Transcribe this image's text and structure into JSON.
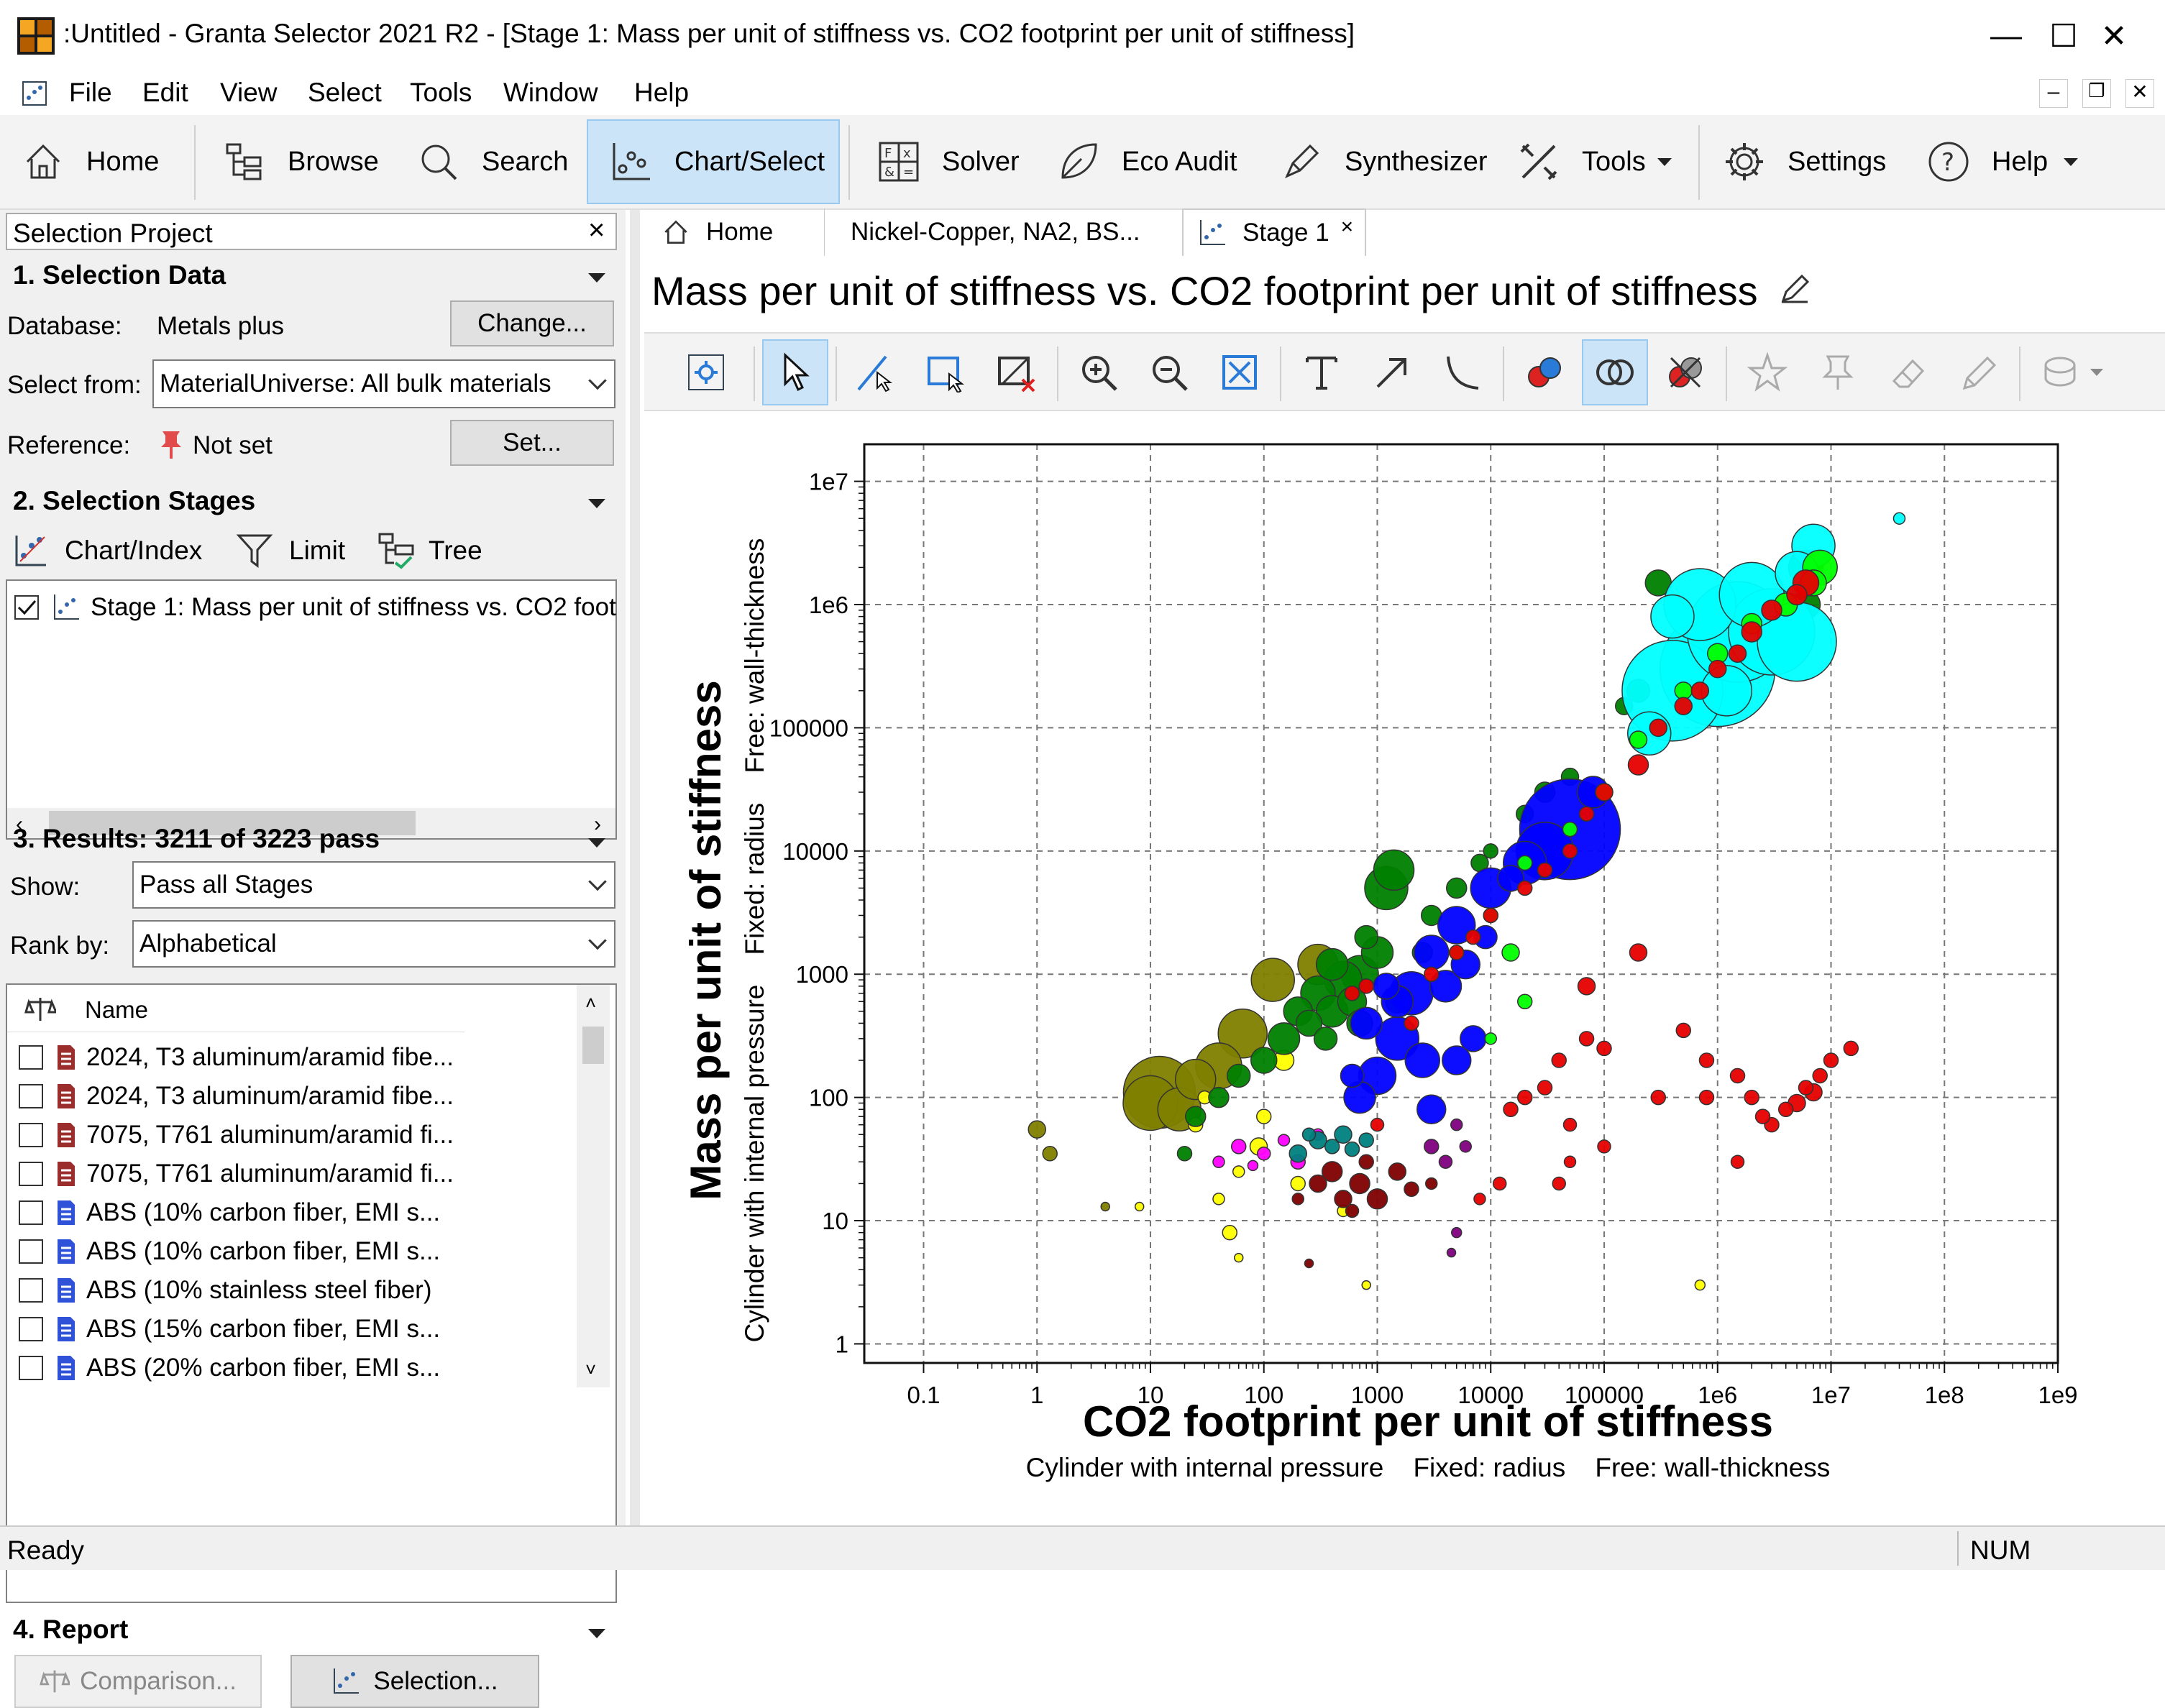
{
  "window": {
    "title": ":Untitled - Granta Selector 2021 R2 - [Stage 1: Mass per unit of stiffness vs. CO2 footprint per unit of stiffness]",
    "minimize": "—",
    "maximize": "☐",
    "close": "✕"
  },
  "menu": {
    "items": [
      "File",
      "Edit",
      "View",
      "Select",
      "Tools",
      "Window",
      "Help"
    ]
  },
  "ribbon": {
    "home": "Home",
    "browse": "Browse",
    "search": "Search",
    "chart_select": "Chart/Select",
    "solver": "Solver",
    "eco_audit": "Eco Audit",
    "synthesizer": "Synthesizer",
    "tools": "Tools",
    "settings": "Settings",
    "help": "Help"
  },
  "left_panel": {
    "header": "Selection Project",
    "close": "×",
    "selection_data": {
      "title": "1. Selection Data",
      "database_label": "Database:",
      "database_value": "Metals plus",
      "change_button": "Change...",
      "select_from_label": "Select from:",
      "select_from_value": "MaterialUniverse: All bulk materials",
      "reference_label": "Reference:",
      "reference_value": "Not set",
      "set_button": "Set..."
    },
    "selection_stages": {
      "title": "2. Selection Stages",
      "chart_index": "Chart/Index",
      "limit": "Limit",
      "tree": "Tree",
      "stages": [
        "Stage 1: Mass per unit of stiffness vs. CO2 foot"
      ]
    },
    "results": {
      "title": "3. Results: 3211 of 3223 pass",
      "show_label": "Show:",
      "show_value": "Pass all Stages",
      "rank_label": "Rank by:",
      "rank_value": "Alphabetical",
      "name_header": "Name",
      "rows": [
        {
          "name": "2024, T3 aluminum/aramid fibe...",
          "color": "#9b2d2d"
        },
        {
          "name": "2024, T3 aluminum/aramid fibe...",
          "color": "#9b2d2d"
        },
        {
          "name": "7075, T761 aluminum/aramid fi...",
          "color": "#9b2d2d"
        },
        {
          "name": "7075, T761 aluminum/aramid fi...",
          "color": "#9b2d2d"
        },
        {
          "name": "ABS (10% carbon fiber, EMI s...",
          "color": "#2f52d8"
        },
        {
          "name": "ABS (10% carbon fiber, EMI s...",
          "color": "#2f52d8"
        },
        {
          "name": "ABS (10% stainless steel fiber)",
          "color": "#2f52d8"
        },
        {
          "name": "ABS (15% carbon fiber, EMI s...",
          "color": "#2f52d8"
        },
        {
          "name": "ABS (20% carbon fiber, EMI s...",
          "color": "#2f52d8"
        }
      ]
    },
    "report": {
      "title": "4. Report",
      "comparison": "Comparison...",
      "selection": "Selection..."
    }
  },
  "tabs": [
    {
      "label": "Home"
    },
    {
      "label": "Nickel-Copper, NA2, BS..."
    },
    {
      "label": "Stage 1",
      "close": "×"
    }
  ],
  "chart_title": "Mass per unit of stiffness vs. CO2 footprint per unit of stiffness",
  "status": {
    "text": "Ready",
    "num": "NUM"
  },
  "chart_data": {
    "type": "scatter",
    "x_scale": "log",
    "y_scale": "log",
    "xlim": [
      0.03,
      1000000000.0
    ],
    "ylim": [
      0.7,
      20000000.0
    ],
    "grid": true,
    "xlabel": "CO2 footprint per unit of stiffness",
    "xsublabel": "Cylinder with internal pressure    Fixed: radius    Free: wall-thickness",
    "ylabel": "Mass per unit of stiffness",
    "ysublabel": "Cylinder with internal pressure    Fixed: radius    Free: wall-thickness",
    "x_ticks": [
      "0.1",
      "1",
      "10",
      "100",
      "1000",
      "10000",
      "100000",
      "1e6",
      "1e7",
      "1e8",
      "1e9"
    ],
    "y_ticks": [
      "1",
      "10",
      "100",
      "1000",
      "10000",
      "100000",
      "1e6",
      "1e7"
    ],
    "series": [
      {
        "color": "#808000",
        "points": [
          [
            1,
            55,
            12
          ],
          [
            1.3,
            35,
            10
          ],
          [
            4,
            13,
            6
          ],
          [
            12,
            110,
            50
          ],
          [
            10,
            90,
            38
          ],
          [
            18,
            80,
            30
          ],
          [
            25,
            140,
            28
          ],
          [
            40,
            180,
            32
          ],
          [
            65,
            330,
            34
          ],
          [
            120,
            900,
            30
          ],
          [
            300,
            1200,
            28
          ]
        ]
      },
      {
        "color": "#ffff00",
        "points": [
          [
            8,
            13,
            6
          ],
          [
            25,
            60,
            10
          ],
          [
            40,
            15,
            8
          ],
          [
            50,
            8,
            10
          ],
          [
            60,
            5,
            6
          ],
          [
            90,
            40,
            12
          ],
          [
            150,
            200,
            14
          ],
          [
            200,
            20,
            10
          ],
          [
            500,
            12,
            8
          ],
          [
            800,
            3,
            6
          ],
          [
            700000,
            3,
            7
          ],
          [
            30,
            100,
            9
          ],
          [
            100,
            70,
            10
          ],
          [
            60,
            25,
            8
          ]
        ]
      },
      {
        "color": "#ff00ff",
        "points": [
          [
            40,
            30,
            8
          ],
          [
            60,
            40,
            10
          ],
          [
            100,
            35,
            9
          ],
          [
            150,
            45,
            8
          ],
          [
            200,
            30,
            10
          ],
          [
            300,
            50,
            8
          ],
          [
            80,
            28,
            7
          ]
        ]
      },
      {
        "color": "#008080",
        "points": [
          [
            200,
            35,
            12
          ],
          [
            300,
            45,
            12
          ],
          [
            400,
            40,
            10
          ],
          [
            500,
            50,
            12
          ],
          [
            600,
            38,
            10
          ],
          [
            800,
            45,
            10
          ],
          [
            250,
            50,
            9
          ]
        ]
      },
      {
        "color": "#800000",
        "points": [
          [
            200,
            15,
            8
          ],
          [
            250,
            4.5,
            6
          ],
          [
            300,
            20,
            12
          ],
          [
            400,
            25,
            14
          ],
          [
            500,
            15,
            12
          ],
          [
            700,
            20,
            14
          ],
          [
            1000,
            15,
            14
          ],
          [
            1500,
            25,
            12
          ],
          [
            2000,
            18,
            10
          ],
          [
            800,
            30,
            10
          ],
          [
            3000,
            20,
            8
          ],
          [
            600,
            12,
            9
          ]
        ]
      },
      {
        "color": "#800080",
        "points": [
          [
            5000,
            60,
            8
          ],
          [
            5000,
            8,
            7
          ],
          [
            4500,
            5.5,
            6
          ],
          [
            6000,
            40,
            8
          ],
          [
            3000,
            40,
            10
          ],
          [
            4000,
            30,
            9
          ]
        ]
      },
      {
        "color": "#008000",
        "points": [
          [
            1200,
            5000,
            30
          ],
          [
            1400,
            7000,
            28
          ],
          [
            1000,
            1500,
            22
          ],
          [
            700,
            1000,
            26
          ],
          [
            500,
            900,
            26
          ],
          [
            300,
            700,
            24
          ],
          [
            400,
            1200,
            22
          ],
          [
            200,
            500,
            20
          ],
          [
            150,
            300,
            22
          ],
          [
            100,
            200,
            18
          ],
          [
            60,
            150,
            16
          ],
          [
            40,
            100,
            14
          ],
          [
            25,
            70,
            14
          ],
          [
            800,
            2000,
            16
          ],
          [
            2500,
            1500,
            14
          ],
          [
            5000,
            5000,
            14
          ],
          [
            8000,
            8000,
            12
          ],
          [
            3000,
            3000,
            14
          ],
          [
            600,
            600,
            20
          ],
          [
            400,
            500,
            22
          ],
          [
            250,
            400,
            18
          ],
          [
            20,
            35,
            10
          ],
          [
            700,
            400,
            18
          ],
          [
            1500,
            600,
            16
          ],
          [
            350,
            300,
            16
          ],
          [
            30000,
            30000,
            14
          ],
          [
            200000,
            200000,
            16
          ],
          [
            1000000,
            1000000,
            14
          ],
          [
            6000000,
            2000000,
            24
          ],
          [
            6000000,
            1000000,
            20
          ],
          [
            50000,
            40000,
            12
          ],
          [
            20000,
            20000,
            12
          ],
          [
            10000,
            10000,
            10
          ],
          [
            300000,
            1500000,
            18
          ],
          [
            150000,
            150000,
            12
          ],
          [
            3000000,
            600000,
            16
          ]
        ]
      },
      {
        "color": "#0000ff",
        "points": [
          [
            50000,
            15000,
            70
          ],
          [
            30000,
            10000,
            40
          ],
          [
            20000,
            8000,
            30
          ],
          [
            10000,
            5000,
            28
          ],
          [
            5000,
            2500,
            26
          ],
          [
            3000,
            1500,
            24
          ],
          [
            2000,
            700,
            30
          ],
          [
            1500,
            300,
            30
          ],
          [
            1000,
            150,
            26
          ],
          [
            700,
            100,
            22
          ],
          [
            3000,
            80,
            20
          ],
          [
            5000,
            200,
            20
          ],
          [
            800,
            400,
            22
          ],
          [
            4000,
            800,
            22
          ],
          [
            6000,
            1200,
            20
          ],
          [
            2500,
            200,
            24
          ],
          [
            1500,
            600,
            22
          ],
          [
            7000,
            300,
            18
          ],
          [
            600,
            150,
            16
          ],
          [
            1200,
            800,
            18
          ],
          [
            9000,
            2000,
            16
          ],
          [
            15000,
            6000,
            18
          ],
          [
            80000,
            30000,
            22
          ],
          [
            250000,
            100000,
            8
          ]
        ]
      },
      {
        "color": "#00ffff",
        "points": [
          [
            40000000,
            5000000,
            8
          ],
          [
            400000,
            200000,
            70
          ],
          [
            1000000,
            300000,
            80
          ],
          [
            1500000,
            600000,
            70
          ],
          [
            3000000,
            600000,
            60
          ],
          [
            5000000,
            500000,
            55
          ],
          [
            700000,
            1000000,
            50
          ],
          [
            2000000,
            1200000,
            45
          ],
          [
            7000000,
            3000000,
            30
          ],
          [
            5000000,
            1800000,
            30
          ],
          [
            250000,
            90000,
            30
          ],
          [
            400000,
            800000,
            30
          ],
          [
            1200000,
            200000,
            35
          ]
        ]
      },
      {
        "color": "#00ff00",
        "points": [
          [
            8000000,
            2000000,
            24
          ],
          [
            7000000,
            1500000,
            18
          ],
          [
            4000000,
            1000000,
            16
          ],
          [
            2000000,
            700000,
            14
          ],
          [
            1000000,
            400000,
            14
          ],
          [
            500000,
            200000,
            12
          ],
          [
            200000,
            80000,
            12
          ],
          [
            100000,
            30000,
            12
          ],
          [
            50000,
            15000,
            10
          ],
          [
            20000,
            8000,
            10
          ],
          [
            10000,
            3000,
            10
          ],
          [
            5000,
            1500,
            10
          ],
          [
            15000,
            1500,
            12
          ],
          [
            20000,
            600,
            10
          ],
          [
            10000,
            300,
            8
          ]
        ]
      },
      {
        "color": "#e60000",
        "points": [
          [
            6000000,
            1500000,
            18
          ],
          [
            5000000,
            1200000,
            14
          ],
          [
            3000000,
            900000,
            14
          ],
          [
            2000000,
            600000,
            14
          ],
          [
            1500000,
            400000,
            12
          ],
          [
            1000000,
            300000,
            12
          ],
          [
            700000,
            200000,
            12
          ],
          [
            500000,
            150000,
            12
          ],
          [
            300000,
            100000,
            12
          ],
          [
            200000,
            50000,
            14
          ],
          [
            100000,
            30000,
            12
          ],
          [
            70000,
            20000,
            10
          ],
          [
            50000,
            10000,
            10
          ],
          [
            30000,
            7000,
            10
          ],
          [
            20000,
            5000,
            10
          ],
          [
            10000,
            3000,
            10
          ],
          [
            7000,
            2000,
            10
          ],
          [
            5000,
            1500,
            10
          ],
          [
            3000,
            1000,
            10
          ],
          [
            200000,
            1500,
            12
          ],
          [
            70000,
            800,
            12
          ],
          [
            40000,
            200,
            10
          ],
          [
            30000,
            120,
            10
          ],
          [
            20000,
            100,
            10
          ],
          [
            15000,
            80,
            10
          ],
          [
            50000,
            60,
            9
          ],
          [
            100000,
            40,
            9
          ],
          [
            100000,
            250,
            10
          ],
          [
            70000,
            300,
            10
          ],
          [
            500000,
            350,
            10
          ],
          [
            800000,
            200,
            10
          ],
          [
            1500000,
            150,
            10
          ],
          [
            2000000,
            100,
            10
          ],
          [
            3000000,
            60,
            10
          ],
          [
            4000000,
            80,
            10
          ],
          [
            6000000,
            120,
            10
          ],
          [
            8000000,
            150,
            10
          ],
          [
            10000000,
            200,
            10
          ],
          [
            15000000,
            250,
            10
          ],
          [
            5000000,
            90,
            12
          ],
          [
            7000000,
            110,
            12
          ],
          [
            2500000,
            70,
            10
          ],
          [
            1500000,
            30,
            9
          ],
          [
            300000,
            100,
            10
          ],
          [
            800000,
            100,
            10
          ],
          [
            50000,
            30,
            8
          ],
          [
            12000,
            20,
            9
          ],
          [
            8000,
            15,
            8
          ],
          [
            1000,
            60,
            9
          ],
          [
            800,
            800,
            10
          ],
          [
            600,
            700,
            10
          ],
          [
            2000,
            400,
            10
          ],
          [
            40000,
            20,
            9
          ]
        ]
      }
    ]
  }
}
